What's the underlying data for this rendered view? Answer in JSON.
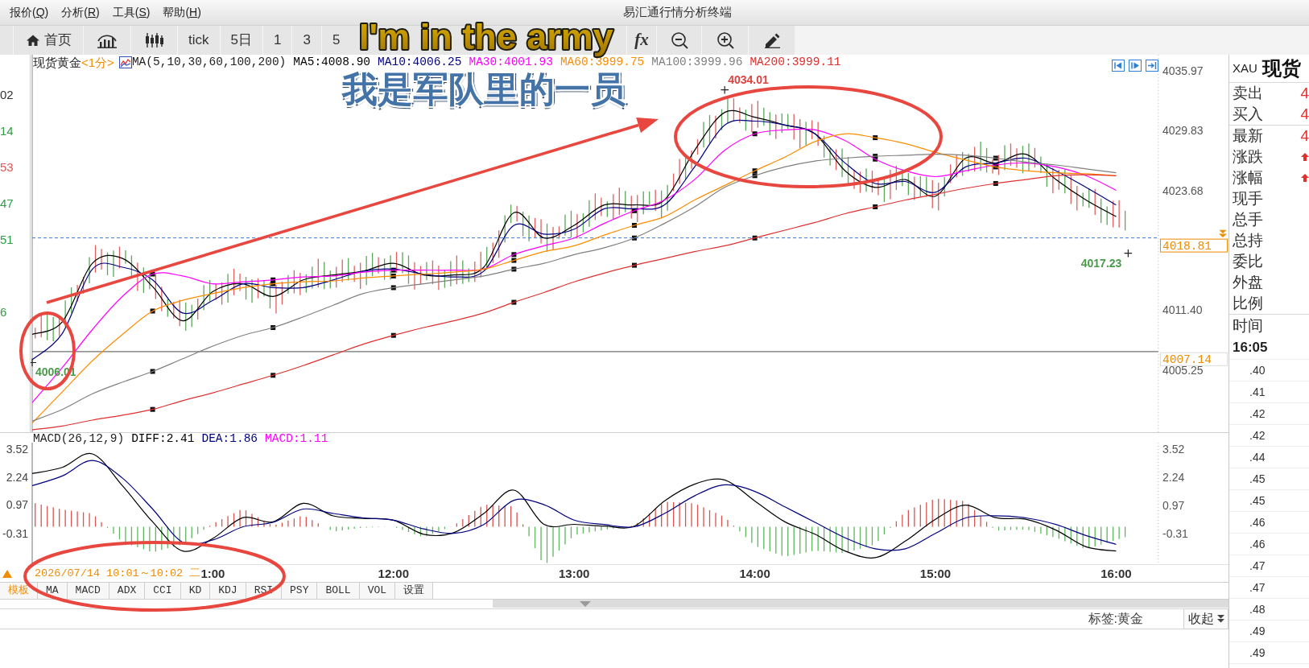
{
  "menu_bar": {
    "menus": [
      "报价(Q)",
      "分析(R)",
      "工具(S)",
      "帮助(H)"
    ],
    "title": "易汇通行情分析终端"
  },
  "toolbar": [
    {
      "kind": "home",
      "label": "首页"
    },
    {
      "kind": "bars"
    },
    {
      "kind": "candles"
    },
    {
      "kind": "text",
      "label": "tick"
    },
    {
      "kind": "text",
      "label": "5日"
    },
    {
      "kind": "text",
      "label": "1"
    },
    {
      "kind": "text",
      "label": "3"
    },
    {
      "kind": "text",
      "label": "5"
    },
    {
      "kind": "formula",
      "label": "fx"
    },
    {
      "kind": "zoom-out"
    },
    {
      "kind": "zoom-in"
    },
    {
      "kind": "pen"
    }
  ],
  "left_panel": [
    {
      "text": "02",
      "color": "#333333"
    },
    {
      "text": "14",
      "color": "#2f9e44"
    },
    {
      "text": "53",
      "color": "#e05555"
    },
    {
      "text": "47",
      "color": "#2f9e44"
    },
    {
      "text": "51",
      "color": "#2f9e44"
    },
    {
      "text": "6",
      "color": "#2f9e44"
    }
  ],
  "main_chart": {
    "title": "现货黄金",
    "period": "<1分>",
    "indicator": "MA(5,10,30,60,100,200)",
    "legend": [
      {
        "text": "MA5:4008.90",
        "color": "#000000"
      },
      {
        "text": "MA10:4006.25",
        "color": "#000080"
      },
      {
        "text": "MA30:4001.93",
        "color": "#ff00ff"
      },
      {
        "text": "MA60:3999.75",
        "color": "#ff8c00"
      },
      {
        "text": "MA100:3999.96",
        "color": "#808080"
      },
      {
        "text": "MA200:3999.11",
        "color": "#e03030"
      }
    ],
    "chart_data": {
      "type": "line",
      "series": [
        {
          "color": "#000000",
          "values": [
            4008.9,
            4010.2,
            4016.2,
            4016.7,
            4013.8,
            4010.3,
            4013.3,
            4014.1,
            4012.8,
            4014.5,
            4015.0,
            4015.4,
            4016.2,
            4015.0,
            4015.0,
            4015.8,
            4021.4,
            4018.8,
            4020.1,
            4022.2,
            4022.2,
            4022.7,
            4027.8,
            4031.7,
            4031.2,
            4030.4,
            4029.5,
            4025.7,
            4024.0,
            4024.8,
            4023.1,
            4027.0,
            4026.5,
            4027.4,
            4024.8,
            4022.7,
            4021.0
          ]
        },
        {
          "color": "#000080",
          "values": [
            4006.3,
            4009.0,
            4015.6,
            4015.8,
            4014.5,
            4011.1,
            4012.4,
            4014.1,
            4013.7,
            4013.7,
            4014.5,
            4015.4,
            4015.6,
            4015.1,
            4014.8,
            4015.4,
            4020.1,
            4019.2,
            4019.7,
            4021.8,
            4021.8,
            4022.2,
            4026.1,
            4030.4,
            4030.8,
            4030.4,
            4029.5,
            4026.5,
            4024.4,
            4024.6,
            4023.5,
            4026.1,
            4026.5,
            4027.0,
            4025.7,
            4024.0,
            4022.2
          ]
        },
        {
          "color": "#ff00ff",
          "values": [
            4001.9,
            4005.5,
            4009.4,
            4012.8,
            4015.1,
            4014.9,
            4014.1,
            4014.3,
            4014.5,
            4014.8,
            4014.9,
            4015.3,
            4015.5,
            4015.5,
            4015.5,
            4015.6,
            4017.1,
            4018.0,
            4018.8,
            4020.3,
            4021.6,
            4022.7,
            4024.8,
            4027.8,
            4029.5,
            4029.9,
            4029.9,
            4028.8,
            4026.9,
            4025.7,
            4025.1,
            4025.7,
            4026.3,
            4026.5,
            4026.1,
            4025.2,
            4023.7
          ]
        },
        {
          "color": "#ff8c00",
          "values": [
            3999.8,
            4003.0,
            4006.2,
            4008.9,
            4011.3,
            4012.4,
            4013.1,
            4013.7,
            4014.1,
            4014.3,
            4014.4,
            4014.7,
            4014.9,
            4015.1,
            4015.3,
            4015.6,
            4016.5,
            4017.4,
            4018.0,
            4019.1,
            4020.1,
            4021.0,
            4022.7,
            4024.2,
            4025.7,
            4027.1,
            4028.7,
            4029.5,
            4029.1,
            4028.5,
            4027.6,
            4026.8,
            4026.1,
            4025.7,
            4025.5,
            4025.4,
            4025.2
          ]
        },
        {
          "color": "#808080",
          "values": [
            4000.0,
            4001.2,
            4002.8,
            4004.0,
            4005.1,
            4006.4,
            4007.7,
            4008.8,
            4009.6,
            4010.7,
            4011.9,
            4013.1,
            4013.7,
            4014.1,
            4014.5,
            4014.9,
            4015.6,
            4016.2,
            4017.1,
            4017.8,
            4018.8,
            4020.3,
            4022.0,
            4024.0,
            4025.2,
            4026.1,
            4026.7,
            4027.0,
            4027.2,
            4027.3,
            4027.4,
            4027.3,
            4027.0,
            4026.6,
            4026.3,
            4025.9,
            4025.5
          ]
        },
        {
          "color": "#e03030",
          "values": [
            3999.1,
            3999.5,
            4000.1,
            4000.6,
            4001.2,
            4002.1,
            4002.9,
            4003.8,
            4004.7,
            4005.7,
            4006.8,
            4007.9,
            4008.8,
            4009.6,
            4010.3,
            4011.1,
            4012.2,
            4013.2,
            4014.3,
            4015.2,
            4016.0,
            4016.7,
            4017.4,
            4018.0,
            4018.8,
            4019.6,
            4020.4,
            4021.3,
            4022.0,
            4022.7,
            4023.3,
            4023.9,
            4024.4,
            4024.8,
            4025.2,
            4025.3,
            4025.2
          ]
        }
      ],
      "ylim": [
        3998.86,
        4037.62
      ],
      "yticks": [
        {
          "value": 4035.97,
          "label": "4035.97"
        },
        {
          "value": 4029.83,
          "label": "4029.83"
        },
        {
          "value": 4023.68,
          "label": "4023.68"
        },
        {
          "value": 4011.4,
          "label": "4011.40"
        },
        {
          "value": 4005.25,
          "label": "4005.25"
        }
      ],
      "ref_lines": [
        {
          "axis": "y",
          "value": 4018.81,
          "label": "4018.81",
          "color": "#3a7bd5"
        },
        {
          "axis": "y",
          "value": 4007.14,
          "label": "4007.14",
          "color": "#707070"
        }
      ],
      "annotations": [
        "4034.01",
        "4006.01",
        "4017.23"
      ]
    }
  },
  "macd_chart": {
    "indicator": "MACD(26,12,9)",
    "legend": [
      {
        "text": "DIFF:2.41",
        "color": "#000000"
      },
      {
        "text": "DEA:1.86",
        "color": "#000080"
      },
      {
        "text": "MACD:1.11",
        "color": "#ff00ff"
      }
    ],
    "left_ticks": [
      "3.52",
      "2.24",
      "0.97",
      "-0.31"
    ],
    "chart_data": {
      "type": "line",
      "categories": [
        null,
        null,
        null,
        null,
        null,
        null,
        "1:00",
        null,
        null,
        null,
        null,
        null,
        "12:00",
        null,
        null,
        null,
        null,
        null,
        "13:00",
        null,
        null,
        null,
        null,
        null,
        "14:00",
        null,
        null,
        null,
        null,
        null,
        "15:00",
        null,
        null,
        null,
        null,
        null,
        "16:00"
      ],
      "series": [
        {
          "color": "#000000",
          "values": [
            2.41,
            2.69,
            3.3,
            1.85,
            0.22,
            -1.1,
            -0.53,
            0.41,
            0.22,
            1.06,
            0.49,
            0.38,
            0.3,
            -0.34,
            -0.27,
            0.6,
            1.66,
            0.11,
            0.11,
            0.03,
            0.03,
            1.17,
            1.93,
            2.12,
            1.17,
            0.22,
            -0.34,
            -1.1,
            -1.4,
            -0.65,
            0.34,
            0.98,
            0.41,
            0.34,
            -0.15,
            -0.91,
            -1.1
          ]
        },
        {
          "color": "#000080",
          "values": [
            1.86,
            2.3,
            3.0,
            2.2,
            0.8,
            -0.7,
            -0.6,
            0.0,
            0.2,
            0.8,
            0.6,
            0.4,
            0.3,
            -0.1,
            -0.3,
            0.1,
            1.2,
            1.0,
            0.3,
            0.1,
            0.0,
            0.6,
            1.4,
            1.9,
            1.6,
            0.9,
            0.2,
            -0.5,
            -1.0,
            -1.0,
            -0.3,
            0.4,
            0.5,
            0.4,
            0.1,
            -0.4,
            -0.8
          ]
        }
      ],
      "ylim": [
        -1.66,
        3.81
      ],
      "yticks": [
        {
          "value": 3.52,
          "label": "3.52"
        },
        {
          "value": 2.24,
          "label": "2.24"
        },
        {
          "value": 0.97,
          "label": "0.97"
        },
        {
          "value": -0.31,
          "label": "-0.31"
        }
      ]
    }
  },
  "time_axis": {
    "cursor_label": "2026/07/14 10:01～10:02 二"
  },
  "indicator_tabs": [
    {
      "label": "模板",
      "selected": true
    },
    {
      "label": "MA",
      "selected": false
    },
    {
      "label": "MACD",
      "selected": false
    },
    {
      "label": "ADX",
      "selected": false
    },
    {
      "label": "CCI",
      "selected": false
    },
    {
      "label": "KD",
      "selected": false
    },
    {
      "label": "KDJ",
      "selected": false
    },
    {
      "label": "RSI",
      "selected": false
    },
    {
      "label": "PSY",
      "selected": false
    },
    {
      "label": "BOLL",
      "selected": false
    },
    {
      "label": "VOL",
      "selected": false
    },
    {
      "label": "设置",
      "selected": false
    }
  ],
  "tag_bar": {
    "label": "标签:黄金",
    "button": "收起"
  },
  "quote_panel": {
    "symbol": "XAU",
    "name": "现货",
    "groups": [
      [
        {
          "label": "卖出",
          "value": "4",
          "rising": false
        },
        {
          "label": "买入",
          "value": "4",
          "rising": false
        }
      ],
      [
        {
          "label": "最新",
          "value": "4",
          "rising": false
        },
        {
          "label": "涨跌",
          "rising": true
        },
        {
          "label": "涨幅",
          "rising": true
        },
        {
          "label": "现手",
          "rising": false
        },
        {
          "label": "总手",
          "rising": false
        },
        {
          "label": "总持",
          "rising": false
        },
        {
          "label": "委比",
          "rising": false
        },
        {
          "label": "外盘",
          "rising": false
        },
        {
          "label": "比例",
          "rising": false
        }
      ]
    ],
    "time_label": "时间",
    "time": "16:05",
    "trades": [
      ".40",
      ".41",
      ".42",
      ".42",
      ".44",
      ".45",
      ".45",
      ".46",
      ".46",
      ".47",
      ".47",
      ".48",
      ".49",
      ".49"
    ]
  },
  "overlay": {
    "caption": [
      "I'm in the army",
      "我是军队里的一员"
    ],
    "markup": [
      {
        "kind": "ellipse"
      },
      {
        "kind": "arrow"
      },
      {
        "kind": "ellipse"
      },
      {
        "kind": "ellipse"
      }
    ]
  }
}
